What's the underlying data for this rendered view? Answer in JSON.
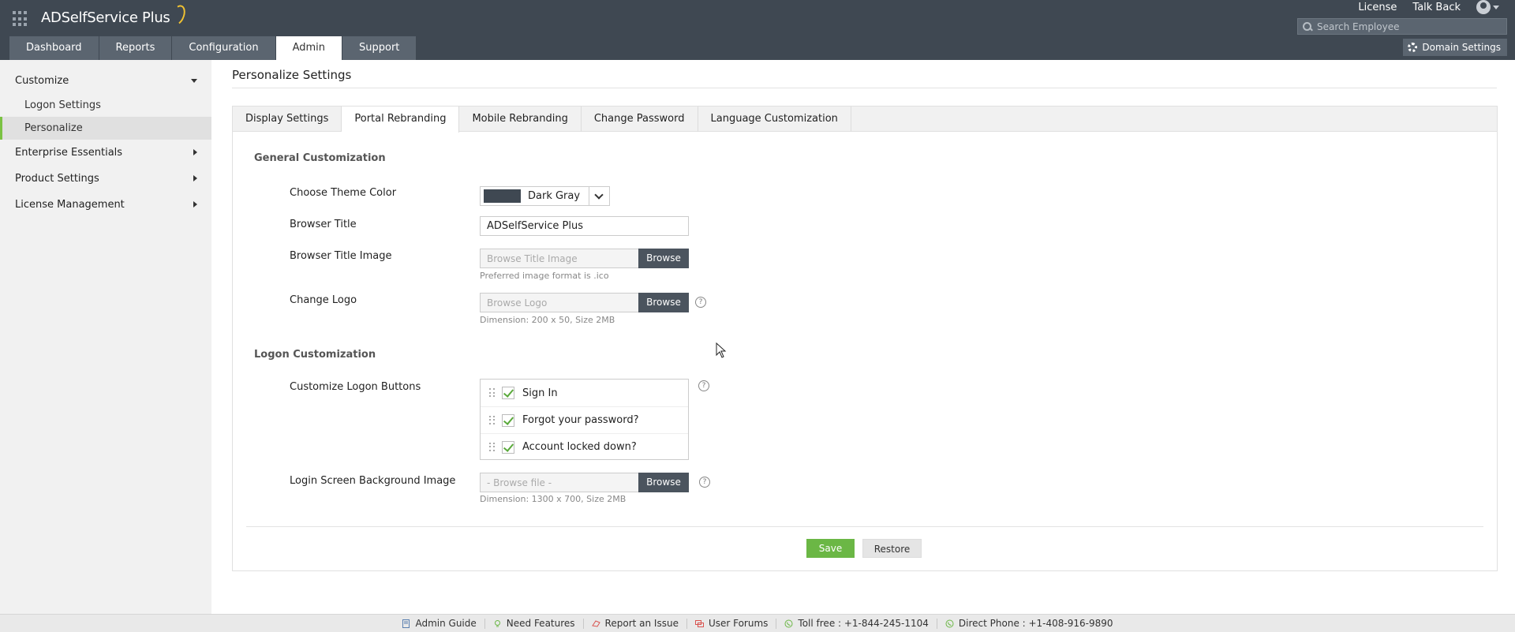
{
  "app": {
    "brand": "ADSelfService Plus"
  },
  "nav": {
    "tabs": [
      "Dashboard",
      "Reports",
      "Configuration",
      "Admin",
      "Support"
    ],
    "active": "Admin"
  },
  "top_links": {
    "license": "License",
    "talk_back": "Talk Back"
  },
  "search": {
    "placeholder": "Search Employee"
  },
  "domain_settings": {
    "label": "Domain Settings"
  },
  "sidebar": {
    "customize": "Customize",
    "sub_items": [
      "Logon Settings",
      "Personalize"
    ],
    "enterprise": "Enterprise Essentials",
    "product": "Product Settings",
    "license": "License Management"
  },
  "page": {
    "title": "Personalize Settings"
  },
  "tabs": [
    "Display Settings",
    "Portal Rebranding",
    "Mobile Rebranding",
    "Change Password",
    "Language Customization"
  ],
  "general": {
    "title": "General Customization",
    "theme_label": "Choose Theme Color",
    "theme_value": "Dark Gray",
    "theme_color": "#3f4852",
    "browser_title_label": "Browser Title",
    "browser_title_value": "ADSelfService Plus",
    "title_image_label": "Browser Title Image",
    "title_image_placeholder": "Browse Title Image",
    "title_image_hint": "Preferred image format is .ico",
    "logo_label": "Change Logo",
    "logo_placeholder": "Browse Logo",
    "logo_hint": "Dimension: 200 x 50, Size 2MB",
    "browse": "Browse"
  },
  "logon": {
    "title": "Logon Customization",
    "buttons_label": "Customize Logon Buttons",
    "buttons": [
      "Sign In",
      "Forgot your password?",
      "Account locked down?"
    ],
    "bg_label": "Login Screen Background Image",
    "bg_placeholder": "- Browse file -",
    "bg_hint": "Dimension: 1300 x 700, Size 2MB"
  },
  "actions": {
    "save": "Save",
    "restore": "Restore"
  },
  "footer": [
    "Admin Guide",
    "Need Features",
    "Report an Issue",
    "User Forums",
    "Toll free : +1-844-245-1104",
    "Direct Phone : +1-408-916-9890"
  ]
}
